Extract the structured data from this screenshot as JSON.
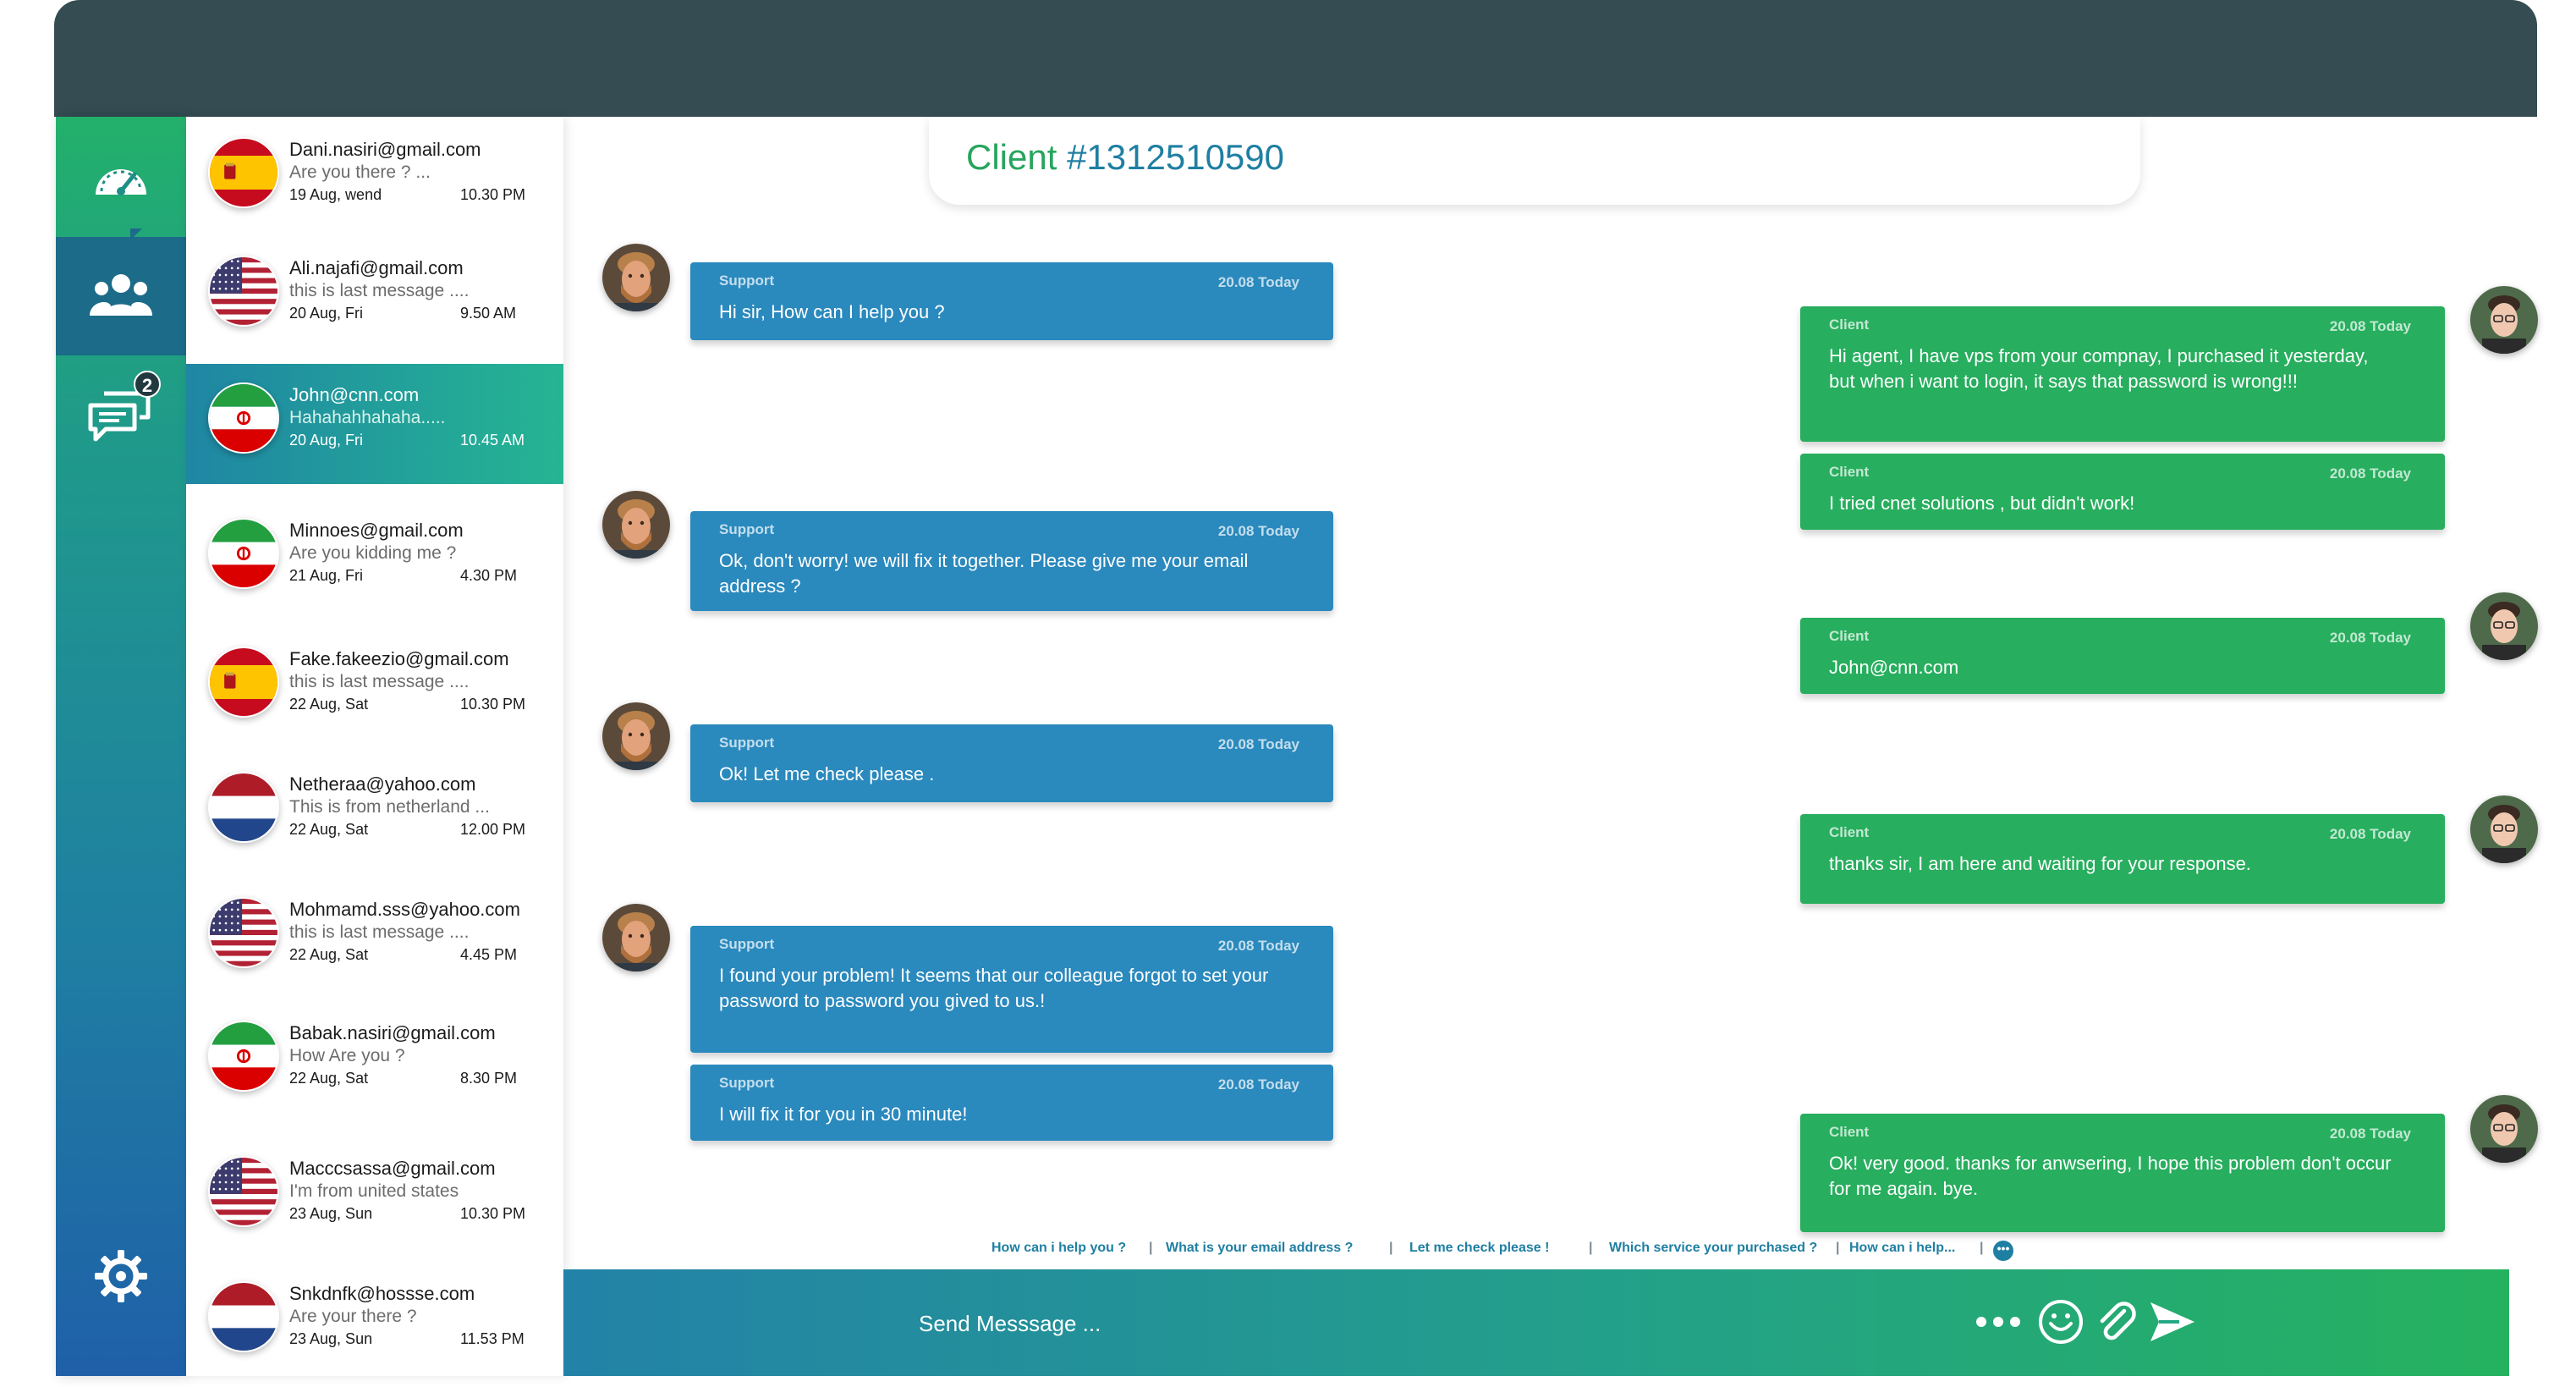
{
  "client_header": {
    "label": "Client",
    "id": "#1312510590"
  },
  "nav": {
    "badge_count": "2",
    "items": [
      "dashboard-icon",
      "users-icon",
      "chat-icon",
      "settings-icon"
    ]
  },
  "contacts": [
    {
      "email": "Dani.nasiri@gmail.com",
      "message": "Are you there ? ...",
      "date": "19 Aug, wend",
      "time": "10.30 PM",
      "flag": "spain"
    },
    {
      "email": "Ali.najafi@gmail.com",
      "message": "this is last message ....",
      "date": "20 Aug, Fri",
      "time": "9.50 AM",
      "flag": "usa"
    },
    {
      "email": "John@cnn.com",
      "message": "Hahahahhahaha.....",
      "date": "20 Aug, Fri",
      "time": "10.45 AM",
      "flag": "iran"
    },
    {
      "email": "Minnoes@gmail.com",
      "message": "Are you kidding me ?",
      "date": "21 Aug, Fri",
      "time": "4.30 PM",
      "flag": "iran"
    },
    {
      "email": "Fake.fakeezio@gmail.com",
      "message": "this is last message ....",
      "date": "22 Aug, Sat",
      "time": "10.30 PM",
      "flag": "spain"
    },
    {
      "email": "Netheraa@yahoo.com",
      "message": "This is from netherland ...",
      "date": "22 Aug, Sat",
      "time": "12.00 PM",
      "flag": "netherlands"
    },
    {
      "email": "Mohmamd.sss@yahoo.com",
      "message": "this is last message ....",
      "date": "22 Aug, Sat",
      "time": "4.45 PM",
      "flag": "usa"
    },
    {
      "email": "Babak.nasiri@gmail.com",
      "message": "How Are you ?",
      "date": "22 Aug, Sat",
      "time": "8.30 PM",
      "flag": "iran"
    },
    {
      "email": "Macccsassa@gmail.com",
      "message": "I'm from united states",
      "date": "23 Aug, Sun",
      "time": "10.30 PM",
      "flag": "usa"
    },
    {
      "email": "Snkdnfk@hossse.com",
      "message": "Are your there ?",
      "date": "23 Aug, Sun",
      "time": "11.53 PM",
      "flag": "netherlands"
    }
  ],
  "messages": {
    "support": [
      {
        "sender": "Support",
        "time": "20.08 Today",
        "text": "Hi sir, How can I help you ?"
      },
      {
        "sender": "Support",
        "time": "20.08 Today",
        "text": "Ok, don't worry! we will fix it together. Please give me your email address ?"
      },
      {
        "sender": "Support",
        "time": "20.08 Today",
        "text": "Ok! Let me check please ."
      },
      {
        "sender": "Support",
        "time": "20.08 Today",
        "text": "I found your problem! It seems that our colleague forgot to set your password to password you gived to us.!"
      },
      {
        "sender": "Support",
        "time": "20.08 Today",
        "text": "I will fix it for you in 30 minute!"
      }
    ],
    "client": [
      {
        "sender": "Client",
        "time": "20.08 Today",
        "text": "Hi agent, I have vps from your compnay, I purchased it yesterday, but when i want to login, it says that password is wrong!!!"
      },
      {
        "sender": "Client",
        "time": "20.08 Today",
        "text": "I tried cnet solutions , but didn't work!"
      },
      {
        "sender": "Client",
        "time": "20.08 Today",
        "text": "John@cnn.com"
      },
      {
        "sender": "Client",
        "time": "20.08 Today",
        "text": "thanks sir, I am here and waiting for your response."
      },
      {
        "sender": "Client",
        "time": "20.08 Today",
        "text": "Ok! very good. thanks for anwsering, I hope this problem don't occur for me again. bye."
      }
    ]
  },
  "quick_replies": [
    "How can i help you ?",
    "What is your email address ?",
    "Let me check please !",
    "Which service your purchased ?",
    "How can i help..."
  ],
  "composer": {
    "placeholder": "Send Messsage ...",
    "icons": [
      "more-icon",
      "emoji-icon",
      "attach-icon",
      "send-icon"
    ]
  },
  "colors": {
    "topbar": "#344c52",
    "support_bubble": "#2a89bd",
    "client_bubble": "#27ae5e",
    "accent_green": "#27a55d",
    "accent_blue": "#1f7fa2"
  }
}
